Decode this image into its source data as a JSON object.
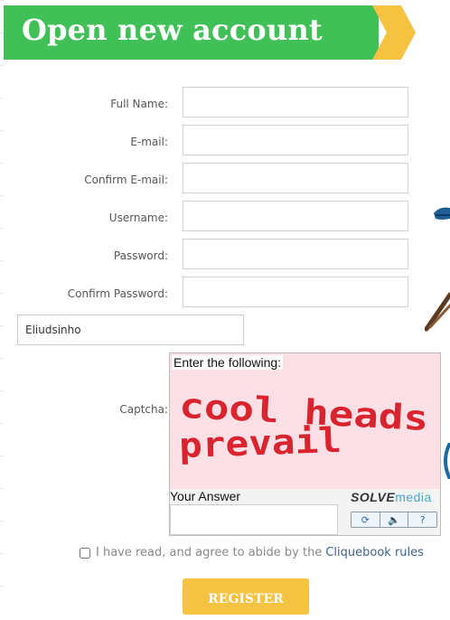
{
  "header": {
    "title": "Open new account"
  },
  "form": {
    "full_name_label": "Full Name:",
    "email_label": "E-mail:",
    "confirm_email_label": "Confirm E-mail:",
    "username_label": "Username:",
    "password_label": "Password:",
    "confirm_password_label": "Confirm Password:",
    "extra_field_value": "Eliudsinho",
    "captcha_label": "Captcha:"
  },
  "captcha": {
    "instruction": "Enter the following:",
    "line1": "cool heads",
    "line2": "prevail",
    "answer_label": "Your Answer",
    "brand_part1": "SOLVE",
    "brand_part2": "media",
    "buttons": {
      "refresh": "⟳",
      "audio": "🔈",
      "help": "?"
    }
  },
  "agree": {
    "text": "I have read, and agree to abide by the",
    "link": "Cliquebook rules"
  },
  "register_label": "REGISTER",
  "colors": {
    "header_green": "#40c057",
    "chevron_yellow": "#f5c242",
    "captcha_text": "#d9232e"
  }
}
